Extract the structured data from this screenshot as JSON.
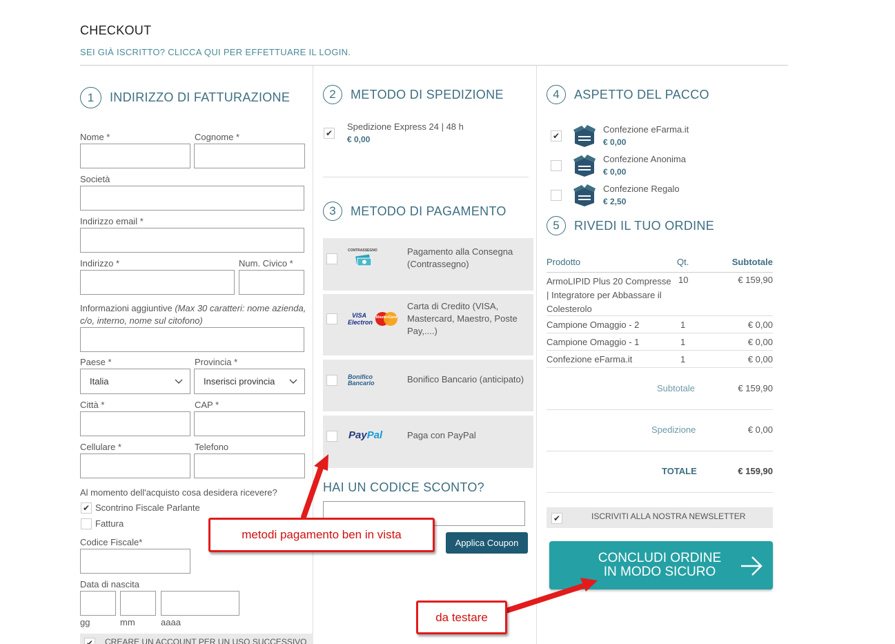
{
  "header": {
    "title": "CHECKOUT",
    "login_link": "SEI GIÀ ISCRITTO? CLICCA QUI PER EFFETTUARE IL LOGIN."
  },
  "billing": {
    "step_number": "1",
    "step_title": "INDIRIZZO DI FATTURAZIONE",
    "nome_label": "Nome *",
    "cognome_label": "Cognome *",
    "societa_label": "Società",
    "email_label": "Indirizzo email *",
    "indirizzo_label": "Indirizzo *",
    "civico_label": "Num. Civico *",
    "info_label": "Informazioni aggiuntive ",
    "info_hint": "(Max 30 caratteri: nome azienda, c/o, interno, nome sul citofono)",
    "paese_label": "Paese *",
    "paese_value": "Italia",
    "provincia_label": "Provincia *",
    "provincia_value": "Inserisci provincia",
    "citta_label": "Città *",
    "cap_label": "CAP *",
    "cellulare_label": "Cellulare *",
    "telefono_label": "Telefono",
    "receipt_question": "Al momento dell'acquisto cosa desidera ricevere?",
    "receipt_option_1": "Scontrino Fiscale Parlante",
    "receipt_option_2": "Fattura",
    "cf_label": "Codice Fiscale*",
    "birth_label": "Data di nascita",
    "birth_gg": "gg",
    "birth_mm": "mm",
    "birth_aaaa": "aaaa",
    "create_account": "CREARE UN ACCOUNT PER UN USO SUCCESSIVO"
  },
  "shipping": {
    "step_number": "2",
    "step_title": "METODO DI SPEDIZIONE",
    "option_label": "Spedizione Express 24 | 48 h",
    "option_price": "€ 0,00"
  },
  "payment": {
    "step_number": "3",
    "step_title": "METODO DI PAGAMENTO",
    "methods": [
      {
        "label": "Pagamento alla Consegna (Contrassegno)",
        "logo": "CONTRASSEGNO"
      },
      {
        "label": "Carta di Credito (VISA, Mastercard, Maestro, Poste Pay,....)",
        "logo_visa": "VISA",
        "logo_electron": "Electron",
        "logo_mc": "MasterCard"
      },
      {
        "label": "Bonifico Bancario (anticipato)",
        "logo": "Bonifico Bancario"
      },
      {
        "label": "Paga con PayPal",
        "logo_pay": "Pay",
        "logo_pal": "Pal"
      }
    ]
  },
  "coupon": {
    "title": "HAI UN CODICE SCONTO?",
    "button": "Applica Coupon"
  },
  "package": {
    "step_number": "4",
    "step_title": "ASPETTO DEL PACCO",
    "options": [
      {
        "label": "Confezione eFarma.it",
        "price": "€ 0,00",
        "checked": true
      },
      {
        "label": "Confezione Anonima",
        "price": "€ 0,00",
        "checked": false
      },
      {
        "label": "Confezione Regalo",
        "price": "€ 2,50",
        "checked": false
      }
    ]
  },
  "review": {
    "step_number": "5",
    "step_title": "RIVEDI IL TUO ORDINE",
    "col_product": "Prodotto",
    "col_qty": "Qt.",
    "col_subtotal": "Subtotale",
    "rows": [
      {
        "product": "ArmoLIPID Plus 20 Compresse | Integratore per Abbassare il Colesterolo",
        "qty": "10",
        "subtotal": "€ 159,90"
      },
      {
        "product": "Campione Omaggio - 2",
        "qty": "1",
        "subtotal": "€ 0,00"
      },
      {
        "product": "Campione Omaggio - 1",
        "qty": "1",
        "subtotal": "€ 0,00"
      },
      {
        "product": "Confezione eFarma.it",
        "qty": "1",
        "subtotal": "€ 0,00"
      }
    ],
    "subtotal_label": "Subtotale",
    "subtotal_value": "€ 159,90",
    "shipping_label": "Spedizione",
    "shipping_value": "€ 0,00",
    "total_label": "TOTALE",
    "total_value": "€ 159,90",
    "newsletter": "ISCRIVITI ALLA NOSTRA NEWSLETTER",
    "order_button_line1": "CONCLUDI ORDINE",
    "order_button_line2": "IN MODO SICURO"
  },
  "annotations": {
    "callout_payment": "metodi pagamento ben in vista",
    "callout_test": "da testare",
    "color": "#e21b1b"
  },
  "colors": {
    "accent": "#3e6f82",
    "order_button": "#25a0a4",
    "coupon_button": "#1e5a73"
  }
}
